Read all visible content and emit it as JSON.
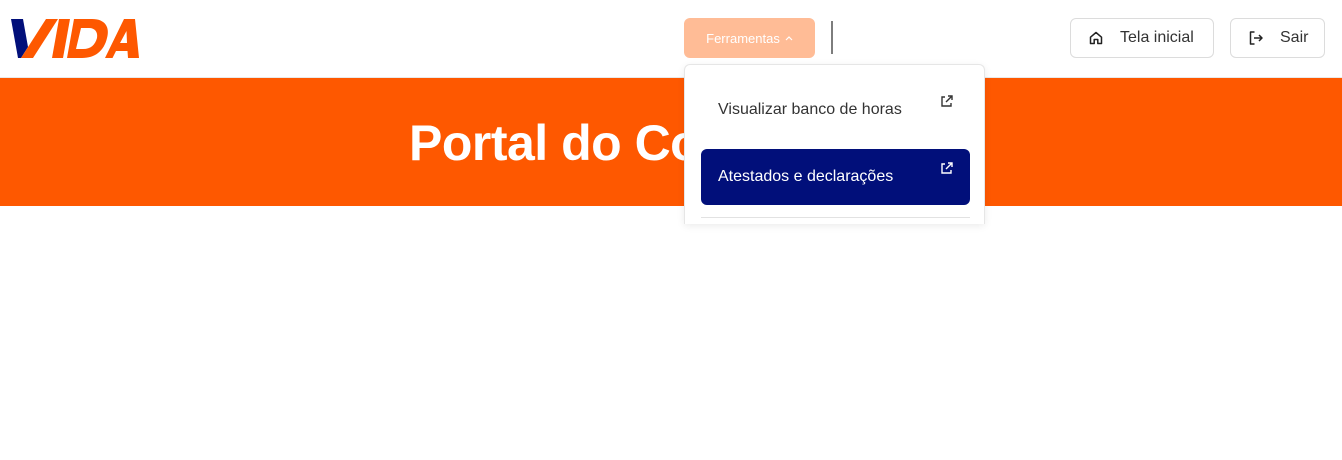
{
  "brand": {
    "logo_text": "VIDA",
    "primary_color": "#fe5800",
    "accent_color": "#010f7a"
  },
  "header": {
    "tools_label": "Ferramentas",
    "home_label": "Tela inicial",
    "logout_label": "Sair"
  },
  "banner": {
    "title": "Portal do Co"
  },
  "dropdown": {
    "items": [
      {
        "label": "Visualizar banco de horas",
        "icon": "external-link-icon",
        "active": false
      },
      {
        "label": "Atestados e declarações",
        "icon": "external-link-icon",
        "active": true
      }
    ]
  },
  "icons": {
    "home": "home-icon",
    "logout": "logout-icon",
    "chevron": "chevron-up-icon"
  }
}
